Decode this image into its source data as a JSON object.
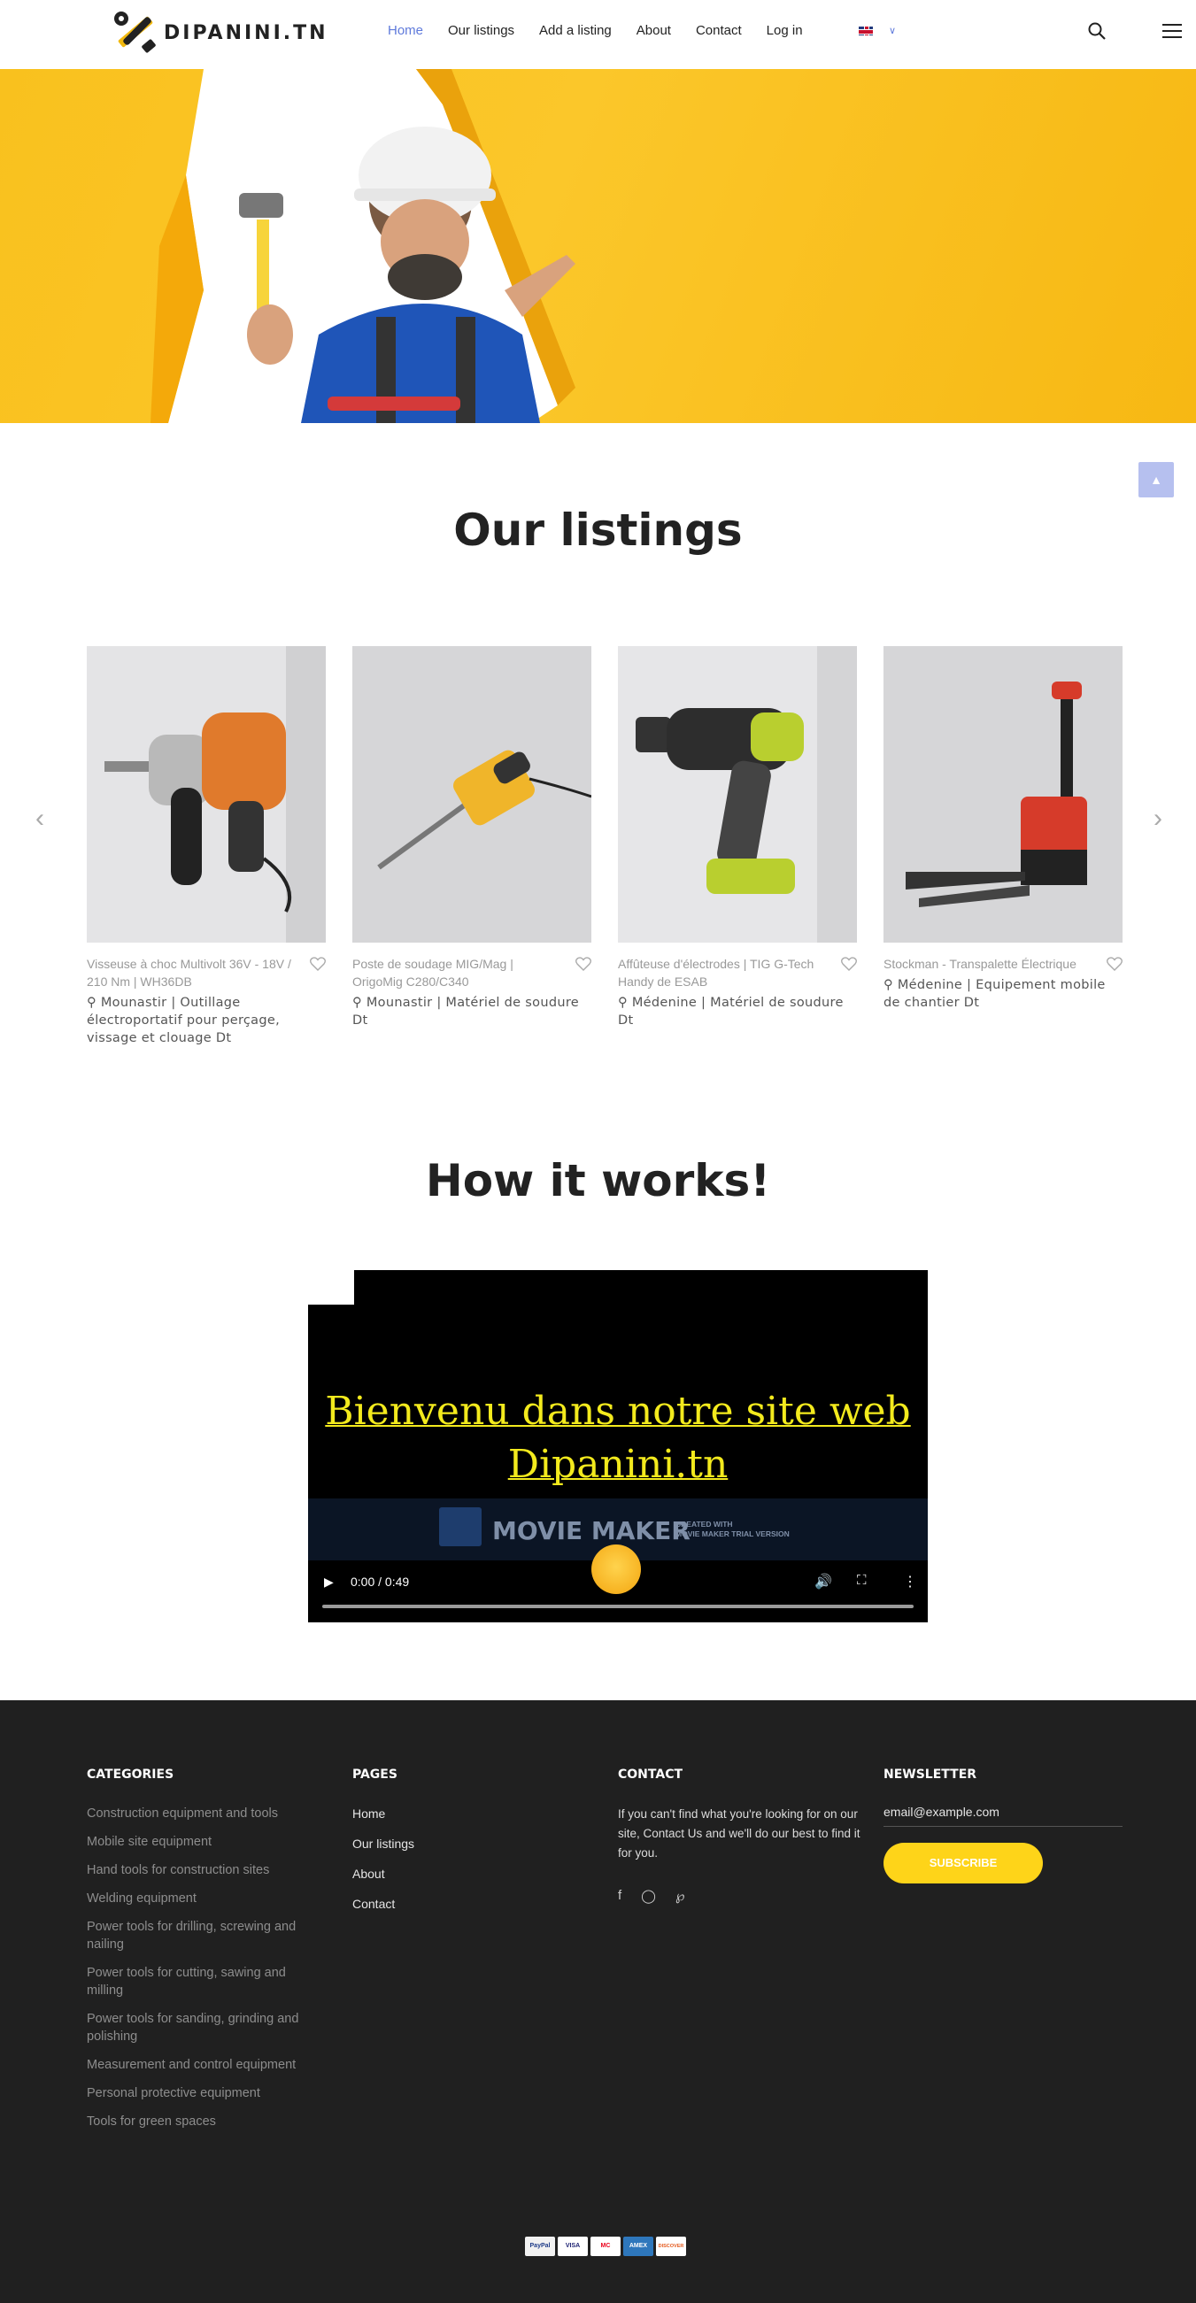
{
  "header": {
    "logo_text": "DIPANINI.TN",
    "nav": [
      {
        "label": "Home",
        "active": true
      },
      {
        "label": "Our listings",
        "active": false
      },
      {
        "label": "Add a listing",
        "active": false
      },
      {
        "label": "About",
        "active": false
      },
      {
        "label": "Contact",
        "active": false
      },
      {
        "label": "Log in",
        "active": false
      }
    ],
    "language_icon": "uk-flag-icon"
  },
  "listings": {
    "title": "Our listings",
    "items": [
      {
        "title": "Visseuse à choc Multivolt 36V - 18V / 210 Nm | WH36DB",
        "location": "Mounastir | Outillage électroportatif pour perçage, vissage et clouage Dt"
      },
      {
        "title": "Poste de soudage MIG/Mag | OrigoMig C280/C340",
        "location": "Mounastir | Matériel de soudure Dt"
      },
      {
        "title": "Affûteuse d'électrodes | TIG G-Tech Handy de ESAB",
        "location": "Médenine | Matériel de soudure Dt"
      },
      {
        "title": "Stockman - Transpalette Électrique",
        "location": "Médenine | Equipement mobile de chantier Dt"
      }
    ]
  },
  "how_it_works": {
    "title": "How it works!",
    "video_text_line1": "Bienvenu  dans notre site web",
    "video_text_line2": "Dipanini.tn",
    "watermark_title": "MOVIE MAKER",
    "watermark_small1": "CREATED WITH",
    "watermark_small2": "MOVIE MAKER TRIAL VERSION",
    "time": "0:00 / 0:49"
  },
  "footer": {
    "categories_title": "CATEGORIES",
    "categories": [
      "Construction equipment and tools",
      "Mobile site equipment",
      "Hand tools for construction sites",
      "Welding equipment",
      "Power tools for drilling, screwing and nailing",
      "Power tools for cutting, sawing and milling",
      "Power tools for sanding, grinding and polishing",
      "Measurement and control equipment",
      "Personal protective equipment",
      "Tools for green spaces"
    ],
    "pages_title": "PAGES",
    "pages": [
      "Home",
      "Our listings",
      "About",
      "Contact"
    ],
    "contact_title": "CONTACT",
    "contact_text": "If you can't find what you're looking for on our site, Contact Us and we'll do our best to find it for you.",
    "newsletter_title": "NEWSLETTER",
    "email_placeholder": "email@example.com",
    "subscribe_label": "SUBSCRIBE",
    "payments": [
      "PayPal",
      "VISA",
      "MC",
      "AMEX",
      "DISCOVER"
    ]
  },
  "colors": {
    "accent": "#5f7adb",
    "hero_yellow": "#f9c11e",
    "subscribe": "#fed419",
    "footer_bg": "#202020"
  }
}
